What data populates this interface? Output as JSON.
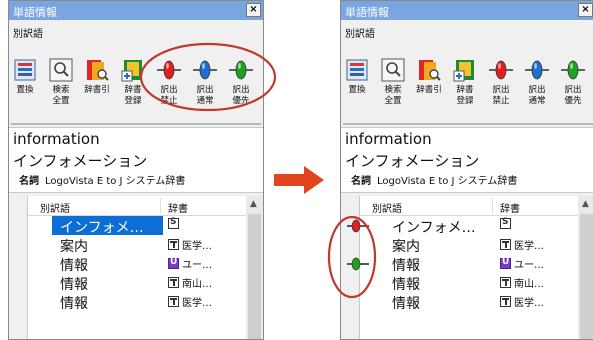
{
  "panels": [
    {
      "title": "単語情報",
      "close_label": "×",
      "section_label": "別訳語",
      "toolbar": [
        {
          "icon": "replace-icon",
          "label": [
            "置換"
          ]
        },
        {
          "icon": "search-all-icon",
          "label": [
            "検索",
            "全置"
          ]
        },
        {
          "icon": "dictionary-lookup-icon",
          "label": [
            "辞書引"
          ]
        },
        {
          "icon": "dictionary-register-icon",
          "label": [
            "辞書",
            "登録"
          ]
        },
        {
          "icon": "red-pin-icon",
          "label": [
            "訳出",
            "禁止"
          ]
        },
        {
          "icon": "blue-pin-icon",
          "label": [
            "訳出",
            "通常"
          ]
        },
        {
          "icon": "green-pin-icon",
          "label": [
            "訳出",
            "優先"
          ]
        }
      ],
      "headword": "information",
      "reading": "インフォメーション",
      "pos": "名詞",
      "dictionary_name": "LogoVista E to J システム辞書",
      "list_headers": {
        "term": "別訳語",
        "dict": "辞書"
      },
      "rows": [
        {
          "term": "インフォメ…",
          "dict_icon": "s",
          "dict": "",
          "selected": true,
          "marker": ""
        },
        {
          "term": "案内",
          "dict_icon": "t",
          "dict": "医学…",
          "selected": false,
          "marker": ""
        },
        {
          "term": "情報",
          "dict_icon": "u",
          "dict": "ユー…",
          "selected": false,
          "marker": ""
        },
        {
          "term": "情報",
          "dict_icon": "t",
          "dict": "南山…",
          "selected": false,
          "marker": ""
        },
        {
          "term": "情報",
          "dict_icon": "t",
          "dict": "医学…",
          "selected": false,
          "marker": ""
        }
      ]
    },
    {
      "title": "単語情報",
      "close_label": "×",
      "section_label": "別訳語",
      "toolbar": [
        {
          "icon": "replace-icon",
          "label": [
            "置換"
          ]
        },
        {
          "icon": "search-all-icon",
          "label": [
            "検索",
            "全置"
          ]
        },
        {
          "icon": "dictionary-lookup-icon",
          "label": [
            "辞書引"
          ]
        },
        {
          "icon": "dictionary-register-icon",
          "label": [
            "辞書",
            "登録"
          ]
        },
        {
          "icon": "red-pin-icon",
          "label": [
            "訳出",
            "禁止"
          ]
        },
        {
          "icon": "blue-pin-icon",
          "label": [
            "訳出",
            "通常"
          ]
        },
        {
          "icon": "green-pin-icon",
          "label": [
            "訳出",
            "優先"
          ]
        }
      ],
      "headword": "information",
      "reading": "インフォメーション",
      "pos": "名詞",
      "dictionary_name": "LogoVista E to J システム辞書",
      "list_headers": {
        "term": "別訳語",
        "dict": "辞書"
      },
      "rows": [
        {
          "term": "インフォメ…",
          "dict_icon": "s",
          "dict": "",
          "selected": false,
          "marker": "red"
        },
        {
          "term": "案内",
          "dict_icon": "t",
          "dict": "医学…",
          "selected": false,
          "marker": ""
        },
        {
          "term": "情報",
          "dict_icon": "u",
          "dict": "ユー…",
          "selected": false,
          "marker": "green"
        },
        {
          "term": "情報",
          "dict_icon": "t",
          "dict": "南山…",
          "selected": false,
          "marker": ""
        },
        {
          "term": "情報",
          "dict_icon": "t",
          "dict": "医学…",
          "selected": false,
          "marker": ""
        }
      ]
    }
  ],
  "colors": {
    "title_bar": "#7aa6e0",
    "selection": "#0d6fd6",
    "annotation": "#c0392b",
    "arrow": "#e0451e",
    "pin_red": "#e02020",
    "pin_blue": "#1f6fd0",
    "pin_green": "#22a022"
  }
}
